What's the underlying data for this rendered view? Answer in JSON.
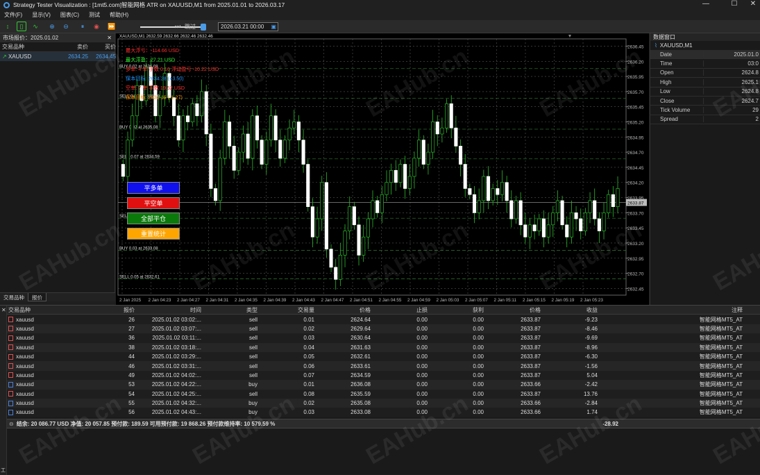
{
  "window": {
    "title": "Strategy Tester Visualization : [1mt5.com]智能网格 ATR on XAUUSD,M1 from 2025.01.01 to 2026.03.17"
  },
  "menu": [
    "文件(F)",
    "显示(V)",
    "图表(C)",
    "测试",
    "帮助(H)"
  ],
  "toolbar": {
    "jump_label": "跳过",
    "date_value": "2026.03.21 00:00"
  },
  "market_watch": {
    "title": "市场报价：2025.01.02",
    "columns": [
      "交易品种",
      "卖价",
      "买价"
    ],
    "rows": [
      {
        "symbol": "XAUUSD",
        "bid": "2634.25",
        "ask": "2634.45"
      }
    ],
    "tabs": [
      "交易品种",
      "报价"
    ]
  },
  "chart": {
    "header": "XAUUSD,M1  2632.59 2632.66 2632.46 2632.46",
    "info_lines": [
      {
        "text": "最大浮亏：-114.66 USD",
        "color": "#ff3030"
      },
      {
        "text": "最大浮盈：27.21 USD",
        "color": "#30ff30"
      },
      {
        "text": "多单: 4 单 手数 0.10 浮动盈亏 -10.22 USD",
        "color": "#ff3030"
      },
      {
        "text": "保本目标: 2634.28 (+3.50)",
        "color": "#1e90ff"
      },
      {
        "text": "空单: 7 单 手数 19.52 USD",
        "color": "#ff3030"
      },
      {
        "text": "保本目标: 2631.15 (-1.27)",
        "color": "#ff8c00"
      }
    ],
    "order_labels": [
      "BUY 0.02 at 2636.08",
      "SELL 0.05 at 2635.59",
      "BUY 0.02 at 2635.08",
      "SELL 0.07 at 2634.59",
      "SELL 0.06 at 2633.61",
      "BUY 0.03 at 2633.08",
      "SELL 0.05 at 2632.61"
    ],
    "price_axis": [
      "2636.45",
      "2636.20",
      "2635.95",
      "2635.70",
      "2635.45",
      "2635.20",
      "2634.95",
      "2634.70",
      "2634.45",
      "2634.20",
      "2633.95",
      "2633.70",
      "2633.45",
      "2633.20",
      "2632.95",
      "2632.70",
      "2632.45"
    ],
    "current_price": "2633.87",
    "time_axis": [
      "2 Jan 2025",
      "2 Jan 04:23",
      "2 Jan 04:27",
      "2 Jan 04:31",
      "2 Jan 04:35",
      "2 Jan 04:39",
      "2 Jan 04:43",
      "2 Jan 04:47",
      "2 Jan 04:51",
      "2 Jan 04:55",
      "2 Jan 04:59",
      "2 Jan 05:03",
      "2 Jan 05:07",
      "2 Jan 05:11",
      "2 Jan 05:15",
      "2 Jan 05:19",
      "2 Jan 05:23"
    ],
    "buttons": [
      {
        "label": "平多单",
        "color": "#1010ee"
      },
      {
        "label": "平空单",
        "color": "#e01010"
      },
      {
        "label": "全部平仓",
        "color": "#0a7a0a"
      },
      {
        "label": "重置统计",
        "color": "#ffa500"
      }
    ]
  },
  "data_window": {
    "title": "数据窗口",
    "symbol": "XAUUSD,M1",
    "rows": [
      {
        "k": "Date",
        "v": "2025.01.0"
      },
      {
        "k": "Time",
        "v": "03:0"
      },
      {
        "k": "Open",
        "v": "2624.8"
      },
      {
        "k": "High",
        "v": "2625.1"
      },
      {
        "k": "Low",
        "v": "2624.8"
      },
      {
        "k": "Close",
        "v": "2624.7"
      },
      {
        "k": "Tick Volume",
        "v": "29"
      },
      {
        "k": "Spread",
        "v": "2"
      }
    ]
  },
  "trades": {
    "columns": [
      "交易品种",
      "报价",
      "时间",
      "类型",
      "交易量",
      "价格",
      "止损",
      "获利",
      "价格",
      "收益",
      "注释"
    ],
    "rows": [
      {
        "side": "sell",
        "symbol": "xauusd",
        "ticket": "26",
        "time": "2025.01.02 03:02:...",
        "type": "sell",
        "volume": "0.01",
        "price": "2624.64",
        "sl": "0.00",
        "tp": "0.00",
        "cur": "2633.87",
        "profit": "-9.23",
        "comment": "智能网格MT5_AT"
      },
      {
        "side": "sell",
        "symbol": "xauusd",
        "ticket": "27",
        "time": "2025.01.02 03:07:...",
        "type": "sell",
        "volume": "0.02",
        "price": "2629.64",
        "sl": "0.00",
        "tp": "0.00",
        "cur": "2633.87",
        "profit": "-8.46",
        "comment": "智能网格MT5_AT"
      },
      {
        "side": "sell",
        "symbol": "xauusd",
        "ticket": "36",
        "time": "2025.01.02 03:11:...",
        "type": "sell",
        "volume": "0.03",
        "price": "2630.64",
        "sl": "0.00",
        "tp": "0.00",
        "cur": "2633.87",
        "profit": "-9.69",
        "comment": "智能网格MT5_AT"
      },
      {
        "side": "sell",
        "symbol": "xauusd",
        "ticket": "38",
        "time": "2025.01.02 03:18:...",
        "type": "sell",
        "volume": "0.04",
        "price": "2631.63",
        "sl": "0.00",
        "tp": "0.00",
        "cur": "2633.87",
        "profit": "-8.96",
        "comment": "智能网格MT5_AT"
      },
      {
        "side": "sell",
        "symbol": "xauusd",
        "ticket": "44",
        "time": "2025.01.02 03:29:...",
        "type": "sell",
        "volume": "0.05",
        "price": "2632.61",
        "sl": "0.00",
        "tp": "0.00",
        "cur": "2633.87",
        "profit": "-6.30",
        "comment": "智能网格MT5_AT"
      },
      {
        "side": "sell",
        "symbol": "xauusd",
        "ticket": "46",
        "time": "2025.01.02 03:31:...",
        "type": "sell",
        "volume": "0.06",
        "price": "2633.61",
        "sl": "0.00",
        "tp": "0.00",
        "cur": "2633.87",
        "profit": "-1.56",
        "comment": "智能网格MT5_AT"
      },
      {
        "side": "sell",
        "symbol": "xauusd",
        "ticket": "49",
        "time": "2025.01.02 04:02:...",
        "type": "sell",
        "volume": "0.07",
        "price": "2634.59",
        "sl": "0.00",
        "tp": "0.00",
        "cur": "2633.87",
        "profit": "5.04",
        "comment": "智能网格MT5_AT"
      },
      {
        "side": "buy",
        "symbol": "xauusd",
        "ticket": "53",
        "time": "2025.01.02 04:22:...",
        "type": "buy",
        "volume": "0.01",
        "price": "2636.08",
        "sl": "0.00",
        "tp": "0.00",
        "cur": "2633.66",
        "profit": "-2.42",
        "comment": "智能网格MT5_AT"
      },
      {
        "side": "sell",
        "symbol": "xauusd",
        "ticket": "54",
        "time": "2025.01.02 04:25:...",
        "type": "sell",
        "volume": "0.08",
        "price": "2635.59",
        "sl": "0.00",
        "tp": "0.00",
        "cur": "2633.87",
        "profit": "13.76",
        "comment": "智能网格MT5_AT"
      },
      {
        "side": "buy",
        "symbol": "xauusd",
        "ticket": "55",
        "time": "2025.01.02 04:32:...",
        "type": "buy",
        "volume": "0.02",
        "price": "2635.08",
        "sl": "0.00",
        "tp": "0.00",
        "cur": "2633.66",
        "profit": "-2.84",
        "comment": "智能网格MT5_AT"
      },
      {
        "side": "buy",
        "symbol": "xauusd",
        "ticket": "56",
        "time": "2025.01.02 04:43:...",
        "type": "buy",
        "volume": "0.03",
        "price": "2633.08",
        "sl": "0.00",
        "tp": "0.00",
        "cur": "2633.66",
        "profit": "1.74",
        "comment": "智能网格MT5_AT"
      }
    ],
    "summary": "结余: 20 086.77 USD  净值: 20 057.85  预付款: 189.59  可用预付款: 19 868.26  预付款维持率: 10 579.59 %",
    "summary_profit": "-28.92"
  },
  "watermark": "EAHub.cn"
}
